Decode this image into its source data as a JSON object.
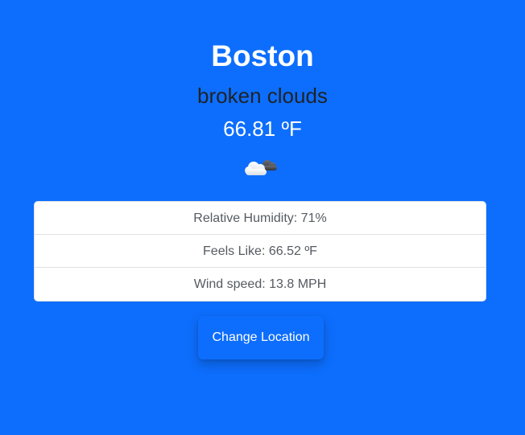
{
  "weather": {
    "city": "Boston",
    "description": "broken clouds",
    "temperature": "66.81 ºF",
    "icon": "broken-clouds-icon"
  },
  "details": [
    {
      "label": "Relative Humidity: 71%"
    },
    {
      "label": "Feels Like: 66.52 ºF"
    },
    {
      "label": "Wind speed: 13.8 MPH"
    }
  ],
  "actions": {
    "change_location_label": "Change Location"
  },
  "colors": {
    "background": "#0d6efd",
    "card": "#ffffff",
    "description_text": "#1f2328",
    "detail_text": "#555b61"
  }
}
